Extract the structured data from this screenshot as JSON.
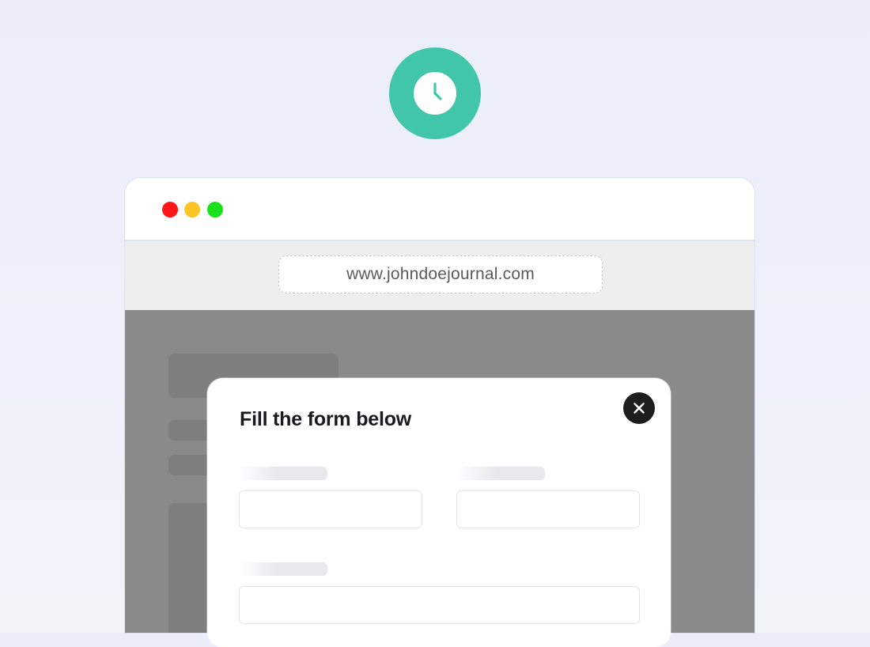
{
  "badge": {
    "icon": "clock-icon",
    "color": "#42c6a9"
  },
  "browser": {
    "traffic_lights": [
      {
        "name": "close",
        "color": "#ff1616"
      },
      {
        "name": "minimize",
        "color": "#ffc425"
      },
      {
        "name": "maximize",
        "color": "#19e01a"
      }
    ],
    "url": "www.johndoejournal.com"
  },
  "modal": {
    "title": "Fill the form below",
    "close_icon": "close-icon",
    "fields": [
      {
        "value": "",
        "placeholder": ""
      },
      {
        "value": "",
        "placeholder": ""
      },
      {
        "value": "",
        "placeholder": ""
      }
    ]
  }
}
